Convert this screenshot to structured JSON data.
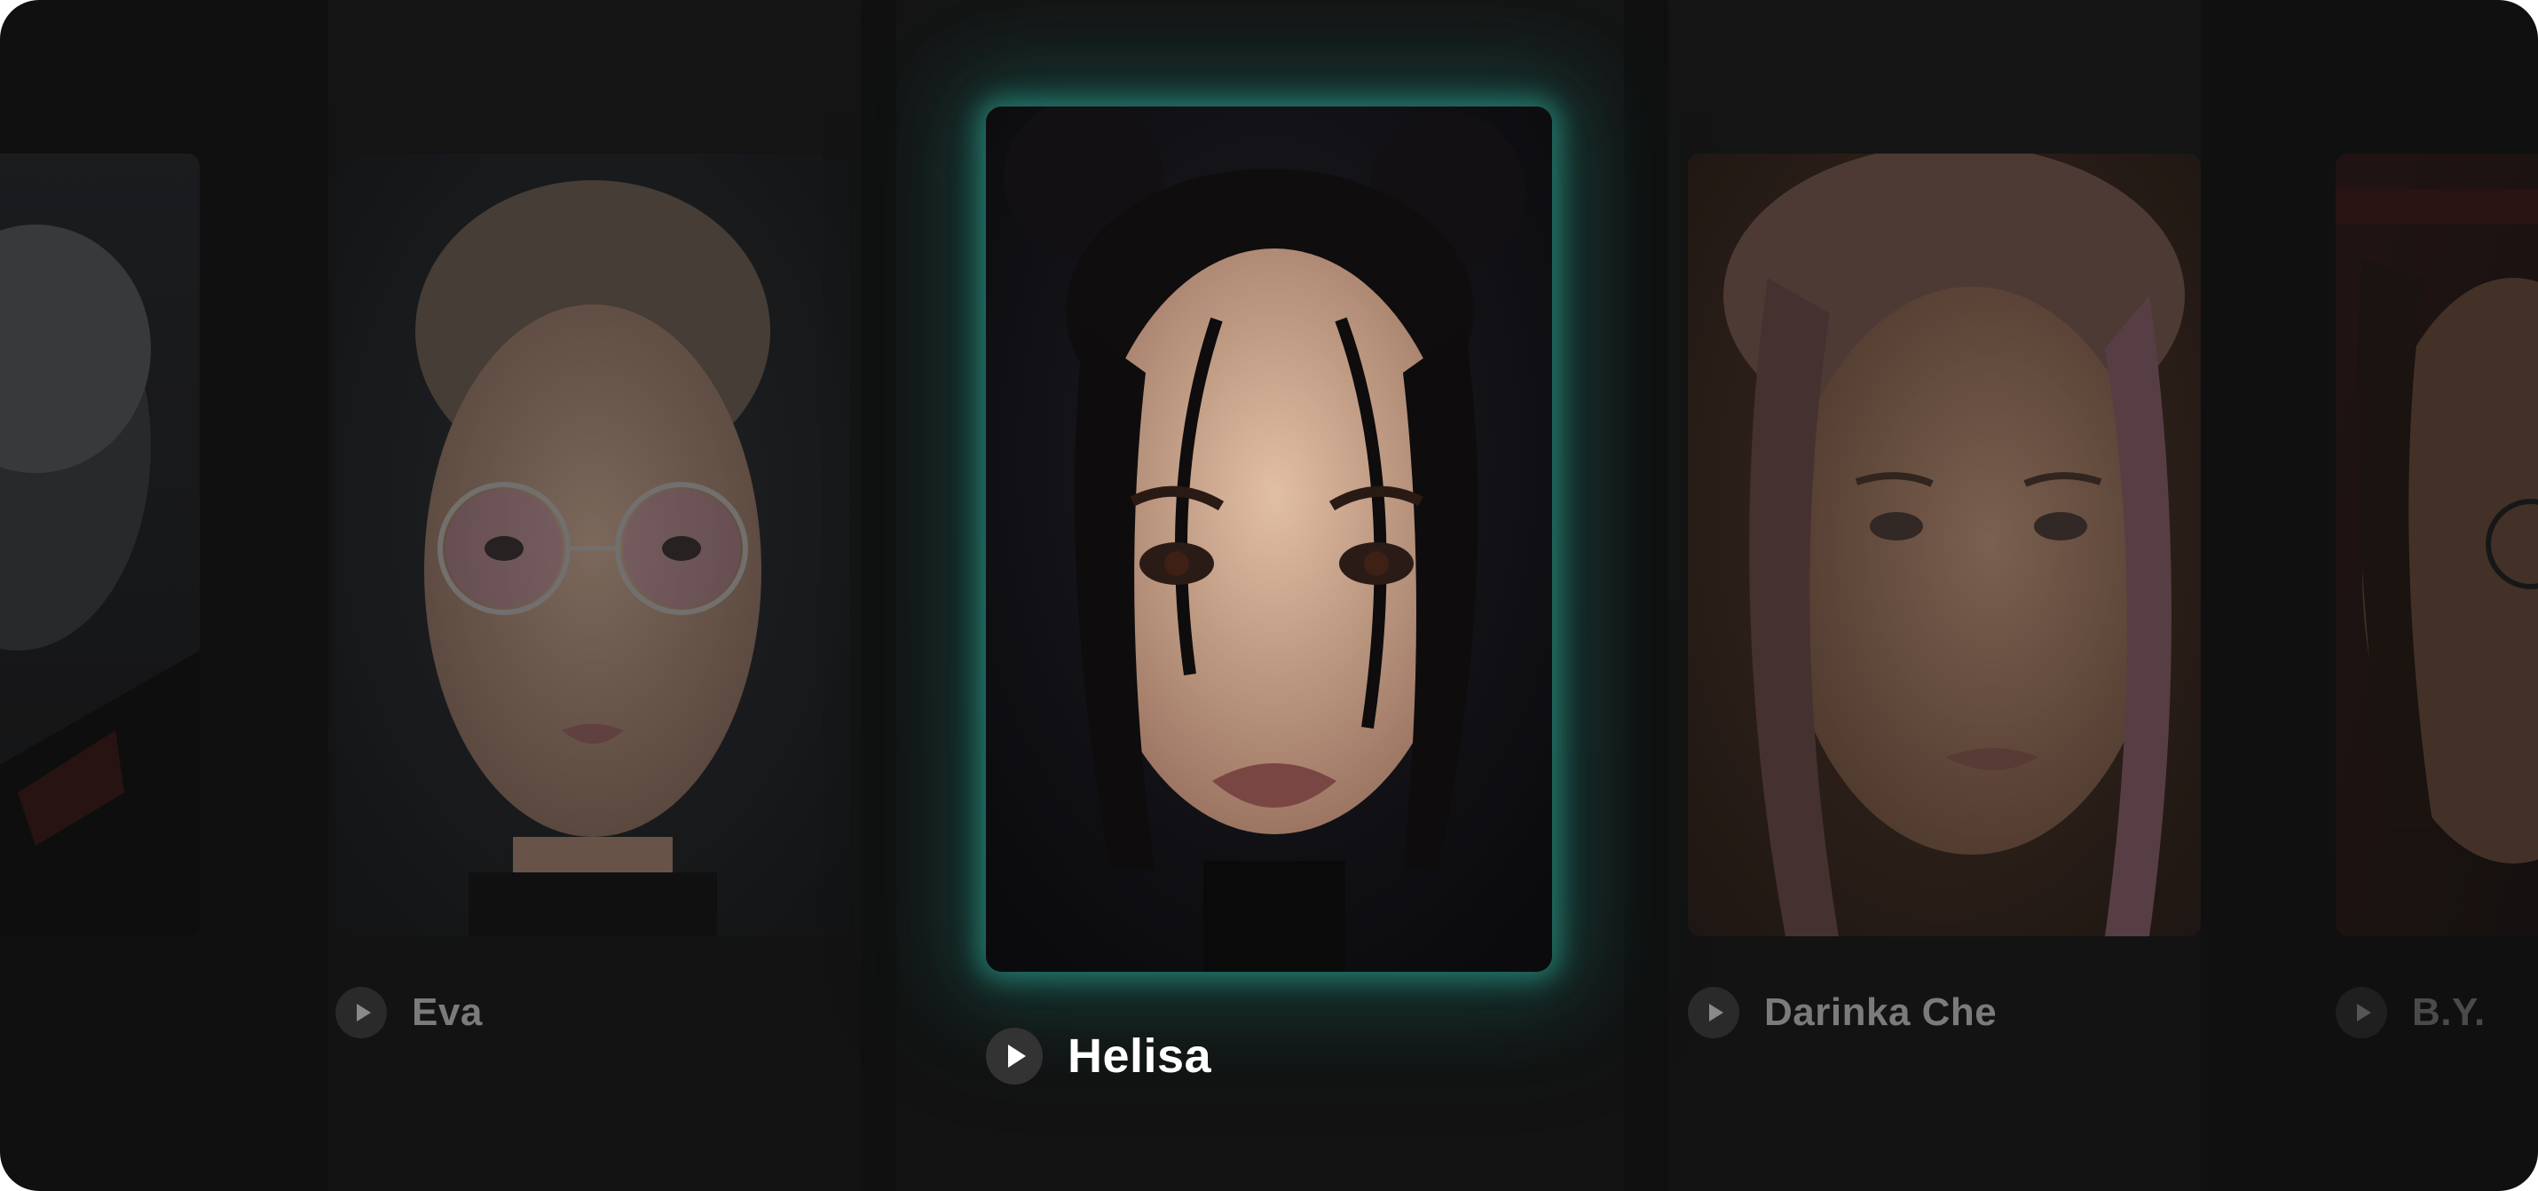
{
  "carousel": {
    "accent_glow": "#2ea896",
    "background": "#101010",
    "items": [
      {
        "name": "",
        "state": "edge-left"
      },
      {
        "name": "Eva",
        "state": "side"
      },
      {
        "name": "Helisa",
        "state": "active"
      },
      {
        "name": "Darinka Che",
        "state": "side"
      },
      {
        "name": "B.Y.",
        "state": "edge-right"
      }
    ],
    "play_icon": "play-icon"
  }
}
